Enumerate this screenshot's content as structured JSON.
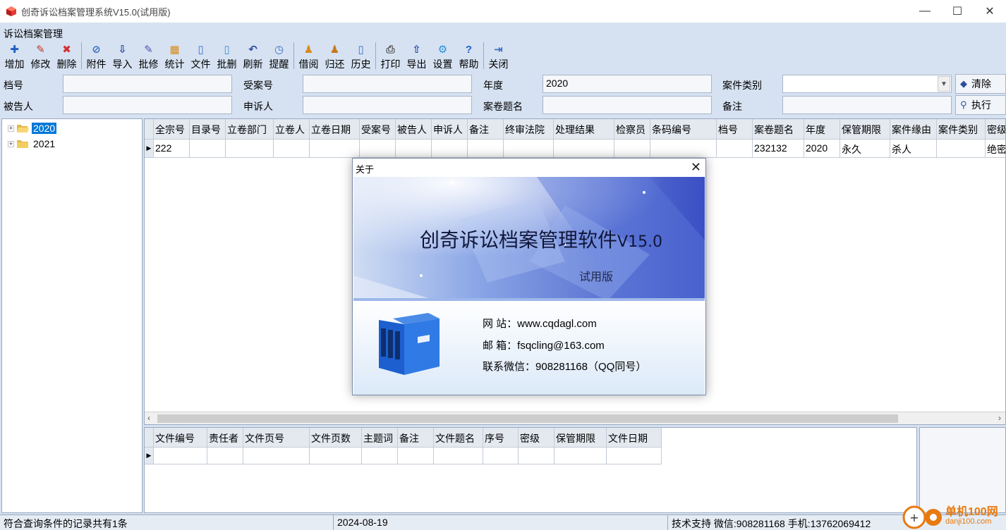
{
  "window": {
    "title": "创奇诉讼档案管理系统V15.0(试用版)",
    "minimize": "—",
    "maximize": "☐",
    "close": "✕"
  },
  "module_label": "诉讼档案管理",
  "toolbar": [
    {
      "label": "增加",
      "icon": "add-icon",
      "glyph": "✚",
      "color": "#1f5fc4"
    },
    {
      "label": "修改",
      "icon": "edit-icon",
      "glyph": "✎",
      "color": "#c0392b"
    },
    {
      "label": "删除",
      "icon": "delete-icon",
      "glyph": "✖",
      "color": "#d32f2f"
    },
    {
      "label": "附件",
      "icon": "attachment-icon",
      "glyph": "⊘",
      "color": "#3b6fc4"
    },
    {
      "label": "导入",
      "icon": "import-icon",
      "glyph": "⇩",
      "color": "#2a4fa0"
    },
    {
      "label": "批修",
      "icon": "batch-edit-icon",
      "glyph": "✎",
      "color": "#5a4fb0"
    },
    {
      "label": "统计",
      "icon": "statistics-icon",
      "glyph": "▦",
      "color": "#d98a1a"
    },
    {
      "label": "文件",
      "icon": "file-icon",
      "glyph": "▯",
      "color": "#3b6fc4"
    },
    {
      "label": "批删",
      "icon": "batch-delete-icon",
      "glyph": "▯",
      "color": "#3b8fd4"
    },
    {
      "label": "刷新",
      "icon": "refresh-icon",
      "glyph": "↶",
      "color": "#2a4fa0"
    },
    {
      "label": "提醒",
      "icon": "reminder-icon",
      "glyph": "◷",
      "color": "#3b6fc4"
    },
    {
      "label": "借阅",
      "icon": "borrow-icon",
      "glyph": "♟",
      "color": "#d98a1a"
    },
    {
      "label": "归还",
      "icon": "return-icon",
      "glyph": "♟",
      "color": "#c7761a"
    },
    {
      "label": "历史",
      "icon": "history-icon",
      "glyph": "▯",
      "color": "#3b6fc4"
    },
    {
      "label": "打印",
      "icon": "print-icon",
      "glyph": "⎙",
      "color": "#555555"
    },
    {
      "label": "导出",
      "icon": "export-icon",
      "glyph": "⇧",
      "color": "#2a4fa0"
    },
    {
      "label": "设置",
      "icon": "settings-icon",
      "glyph": "⚙",
      "color": "#2a8fd4"
    },
    {
      "label": "帮助",
      "icon": "help-icon",
      "glyph": "?",
      "color": "#1f5fc4"
    },
    {
      "label": "关闭",
      "icon": "close-door-icon",
      "glyph": "⇥",
      "color": "#3b6fc4"
    }
  ],
  "form": {
    "archive_no_label": "档号",
    "case_no_label": "受案号",
    "year_label": "年度",
    "year_value": "2020",
    "case_type_label": "案件类别",
    "defendant_label": "被告人",
    "appellant_label": "申诉人",
    "case_title_label": "案卷题名",
    "remark_label": "备注",
    "clear_button": "清除",
    "execute_button": "执行"
  },
  "tree": {
    "items": [
      {
        "label": "2020",
        "selected": true
      },
      {
        "label": "2021",
        "selected": false
      }
    ]
  },
  "main_grid": {
    "columns": [
      "全宗号",
      "目录号",
      "立卷部门",
      "立卷人",
      "立卷日期",
      "受案号",
      "被告人",
      "申诉人",
      "备注",
      "终审法院",
      "处理结果",
      "检察员",
      "条码编号",
      "档号",
      "案卷题名",
      "年度",
      "保管期限",
      "案件缘由",
      "案件类别",
      "密级"
    ],
    "rows": [
      [
        "222",
        "",
        "",
        "",
        "",
        "",
        "",
        "",
        "",
        "",
        "",
        "",
        "",
        "",
        "232132",
        "2020",
        "永久",
        "杀人",
        "",
        "绝密"
      ]
    ]
  },
  "sub_grid": {
    "columns": [
      "文件编号",
      "责任者",
      "文件页号",
      "文件页数",
      "主题词",
      "备注",
      "文件题名",
      "序号",
      "密级",
      "保管期限",
      "文件日期"
    ]
  },
  "status": {
    "record_count": "符合查询条件的记录共有1条",
    "date": "2024-08-19",
    "support": "技术支持 微信:908281168 手机:13762069412"
  },
  "about_dialog": {
    "title": "关于",
    "product_name": "创奇诉讼档案管理软件",
    "version": "V15.0",
    "edition": "试用版",
    "website_label": "网  站：",
    "website": "www.cqdagl.com",
    "email_label": "邮  箱：",
    "email": "fsqcling@163.com",
    "wechat_label": "联系微信：",
    "wechat": "908281168（QQ同号）"
  },
  "watermark": {
    "name": "单机100网",
    "url": "danji100.com"
  }
}
